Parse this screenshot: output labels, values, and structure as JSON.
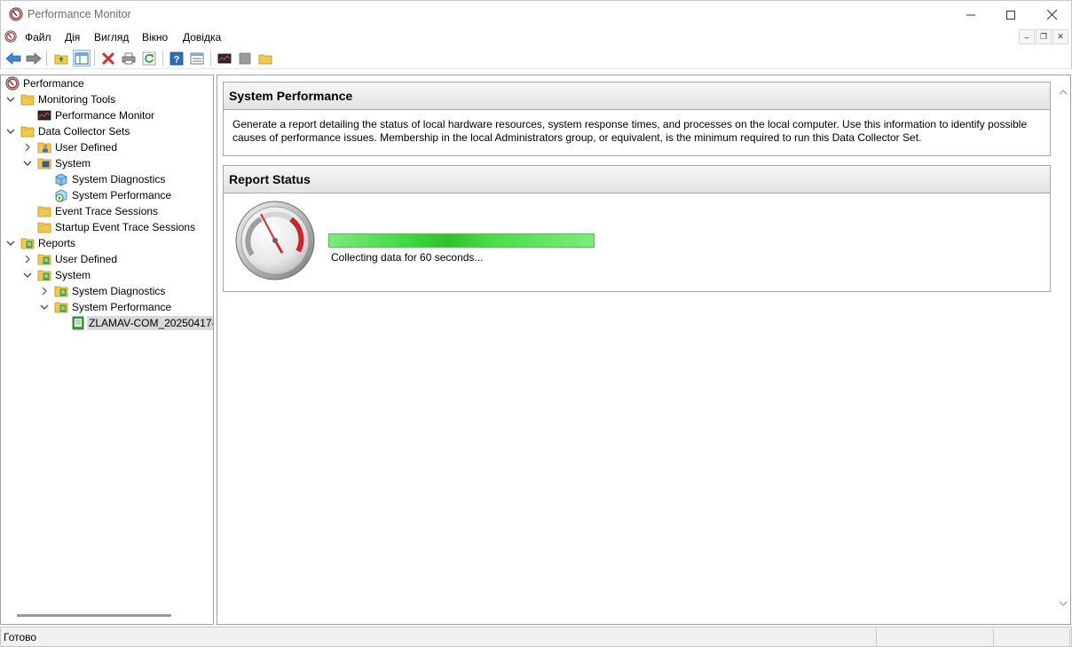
{
  "window": {
    "title": "Performance Monitor"
  },
  "menu": {
    "items": [
      "Файл",
      "Дія",
      "Вигляд",
      "Вікно",
      "Довідка"
    ]
  },
  "tree": {
    "items": [
      {
        "label": "Performance",
        "level": 0,
        "expander": "",
        "icon": "perfmon-icon"
      },
      {
        "label": "Monitoring Tools",
        "level": 0,
        "expander": "expanded",
        "icon": "folder-icon"
      },
      {
        "label": "Performance Monitor",
        "level": 1,
        "expander": "",
        "icon": "monitor-chart-icon"
      },
      {
        "label": "Data Collector Sets",
        "level": 0,
        "expander": "expanded",
        "icon": "folder-icon"
      },
      {
        "label": "User Defined",
        "level": 1,
        "expander": "collapsed",
        "icon": "user-folder-icon"
      },
      {
        "label": "System",
        "level": 1,
        "expander": "expanded",
        "icon": "system-folder-icon"
      },
      {
        "label": "System Diagnostics",
        "level": 2,
        "expander": "",
        "icon": "collector-set-icon"
      },
      {
        "label": "System Performance",
        "level": 2,
        "expander": "",
        "icon": "collector-running-icon"
      },
      {
        "label": "Event Trace Sessions",
        "level": 1,
        "expander": "",
        "icon": "folder-icon"
      },
      {
        "label": "Startup Event Trace Sessions",
        "level": 1,
        "expander": "",
        "icon": "folder-icon"
      },
      {
        "label": "Reports",
        "level": 0,
        "expander": "expanded",
        "icon": "report-folder-icon"
      },
      {
        "label": "User Defined",
        "level": 1,
        "expander": "collapsed",
        "icon": "report-folder-icon"
      },
      {
        "label": "System",
        "level": 1,
        "expander": "expanded",
        "icon": "report-folder-icon"
      },
      {
        "label": "System Diagnostics",
        "level": 2,
        "expander": "collapsed",
        "icon": "report-folder-icon"
      },
      {
        "label": "System Performance",
        "level": 2,
        "expander": "expanded",
        "icon": "report-folder-icon"
      },
      {
        "label": "ZLAMAV-COM_20250417-",
        "level": 3,
        "expander": "",
        "icon": "report-doc-icon",
        "selected": true
      }
    ]
  },
  "content": {
    "system_performance": {
      "heading": "System Performance",
      "description": "Generate a report detailing the status of local hardware resources, system response times, and processes on the local computer. Use this information to identify possible causes of performance issues. Membership in the local Administrators group, or equivalent, is the minimum required to run this Data Collector Set."
    },
    "report_status": {
      "heading": "Report Status",
      "status_text": "Collecting data for 60 seconds..."
    }
  },
  "statusbar": {
    "text": "Готово"
  }
}
